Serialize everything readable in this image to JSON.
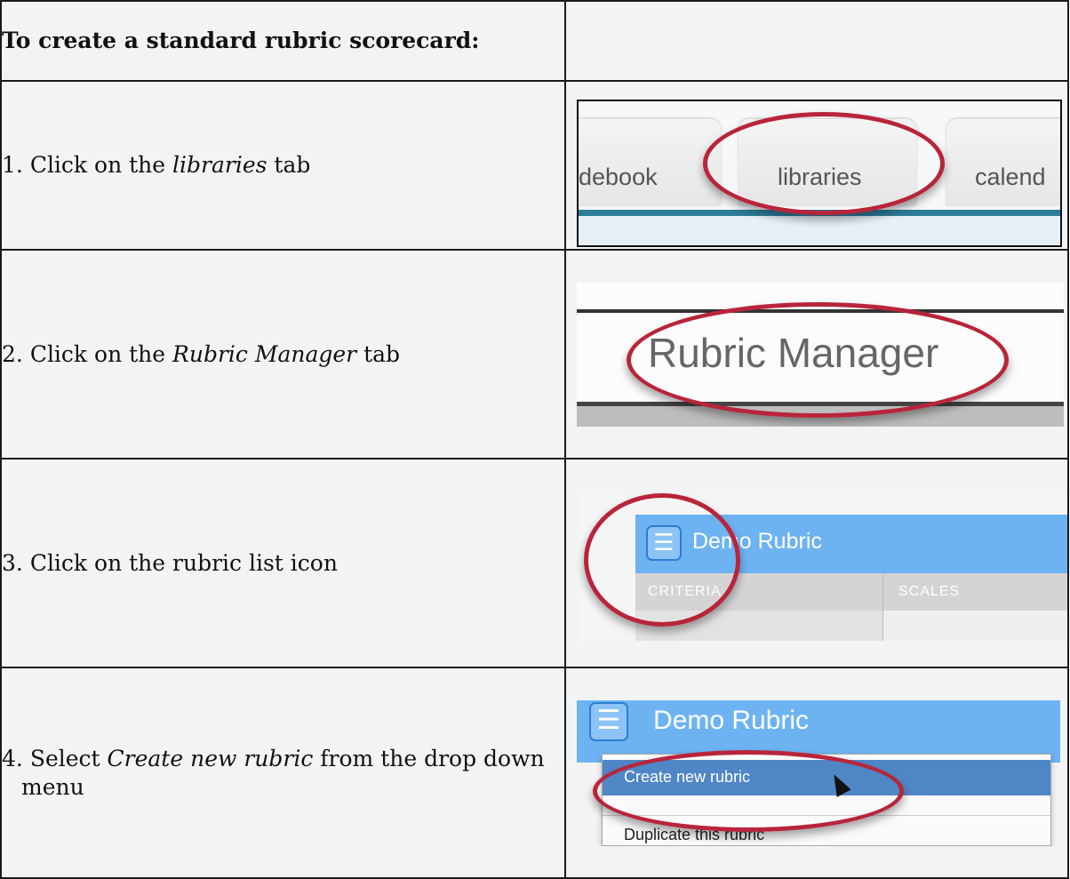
{
  "header": {
    "title": "To create a standard rubric scorecard:"
  },
  "steps": [
    {
      "num": "1.",
      "pre": "Click on the ",
      "em": "libraries",
      "post": " tab",
      "shot": {
        "tabs": [
          "debook",
          "libraries",
          "calend"
        ]
      }
    },
    {
      "num": "2.",
      "pre": "Click on the ",
      "em": "Rubric Manager",
      "post": " tab",
      "shot": {
        "tab": "Rubric Manager"
      }
    },
    {
      "num": "3.",
      "pre": "Click on the rubric list icon",
      "em": "",
      "post": "",
      "shot": {
        "title": "Demo Rubric",
        "col1": "CRITERIA",
        "col2": "SCALES"
      }
    },
    {
      "num": "4.",
      "pre": "Select ",
      "em": "Create new rubric",
      "post": " from the drop down menu",
      "shot": {
        "title": "Demo Rubric",
        "options": [
          "Create new rubric",
          "Duplicate this rubric"
        ]
      }
    }
  ],
  "colors": {
    "highlight_ring": "#b8253a",
    "rubric_bar": "#6db3f2",
    "menu_selected": "#4f86c6"
  }
}
